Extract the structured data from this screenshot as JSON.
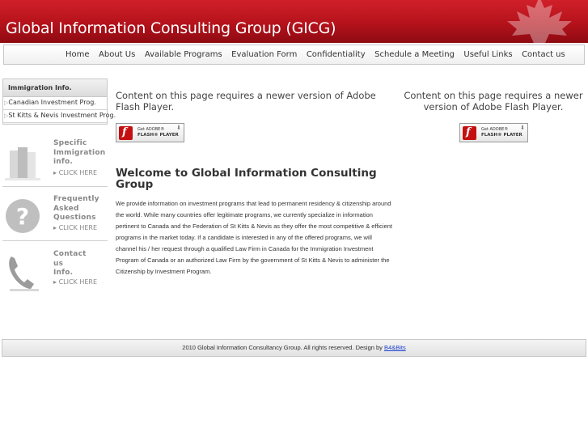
{
  "header": {
    "title": "Global Information Consulting Group (GICG)"
  },
  "nav": {
    "items": [
      "Home",
      "About Us",
      "Available Programs",
      "Evaluation Form",
      "Confidentiality",
      "Schedule a Meeting",
      "Useful Links",
      "Contact us"
    ]
  },
  "sidebar": {
    "box_title": "Immigration Info.",
    "links": [
      "Canadian Investment Prog.",
      "St Kitts & Nevis Investment Prog."
    ],
    "promos": [
      {
        "text": [
          "Specific",
          "Immigration",
          "info."
        ],
        "click": "CLICK HERE",
        "icon": "building-icon"
      },
      {
        "text": [
          "Frequently",
          "Asked",
          "Questions"
        ],
        "click": "CLICK HERE",
        "icon": "question-icon"
      },
      {
        "text": [
          "Contact",
          "us",
          "Info."
        ],
        "click": "CLICK HERE",
        "icon": "phone-icon"
      }
    ]
  },
  "flash": {
    "message_left": "Content on this page requires a newer version of Adobe Flash Player.",
    "message_right": "Content on this page requires a newer version of Adobe Flash Player.",
    "button_line1": "Get ADOBE®",
    "button_line2": "FLASH® PLAYER"
  },
  "main": {
    "title": "Welcome to Global Information Consulting Group",
    "body": "We provide information on investment programs that lead to permanent residency & citizenship around the world. While many countries offer legitimate programs, we currently specialize in information pertinent to Canada and the Federation of St Kitts & Nevis as they offer the most competitive & efficient programs in the market today. If a candidate is interested in any of the offered programs, we will channel his / her request through a qualified Law Firm in Canada for the Immigration Investment Program of Canada or an authorized Law Firm by the government of St Kitts & Nevis to administer the Citizenship by Investment Program."
  },
  "footer": {
    "text": "2010 Global Information Consultancy Group. All rights reserved. Design by ",
    "link": "B4&Bits"
  },
  "colors": {
    "header_red": "#b5121b",
    "flash_red": "#c41010",
    "link_blue": "#1a3fcc"
  }
}
